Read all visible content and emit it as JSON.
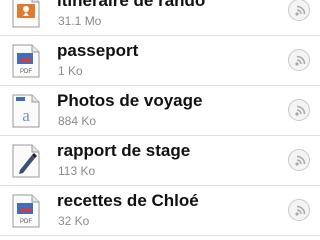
{
  "files": [
    {
      "name": "itinéraire de rando",
      "size": "31.1 Mo",
      "icon": "map-pin-document-icon"
    },
    {
      "name": "passeport",
      "size": "1 Ko",
      "icon": "pdf-file-icon",
      "badge": "PDF"
    },
    {
      "name": "Photos de voyage",
      "size": "884 Ko",
      "icon": "text-document-icon"
    },
    {
      "name": "rapport de stage",
      "size": "113 Ko",
      "icon": "pen-document-icon"
    },
    {
      "name": "recettes de Chloé",
      "size": "32 Ko",
      "icon": "pdf-file-icon",
      "badge": "PDF"
    }
  ],
  "colors": {
    "divider": "#e0e0e0",
    "meta_text": "#8a8a8a",
    "accent_orange": "#e07a2e",
    "accent_blue": "#3a6fc4"
  }
}
